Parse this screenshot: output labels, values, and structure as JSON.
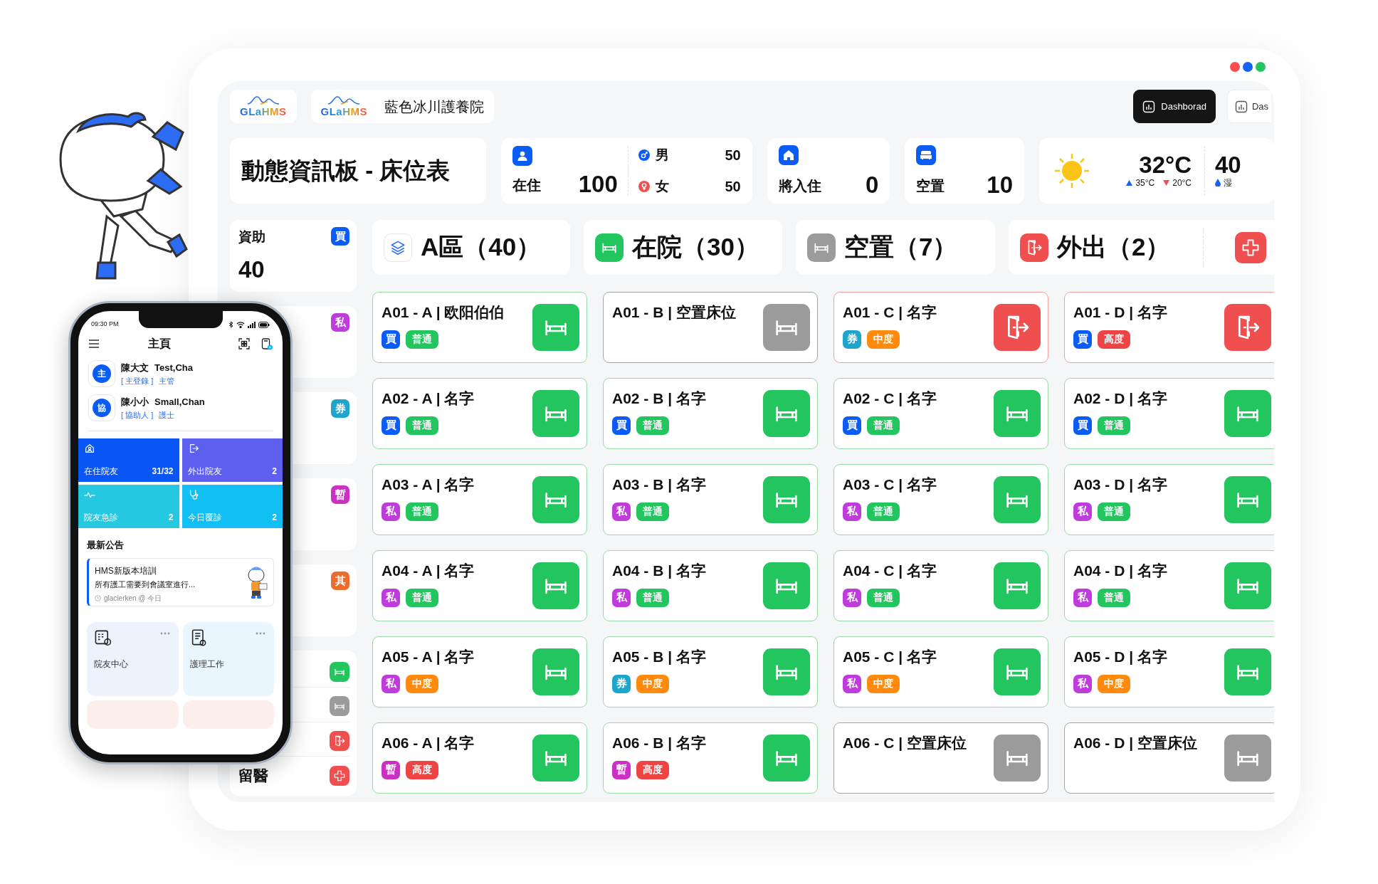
{
  "window_controls": [
    {
      "color": "#ff4d4f"
    },
    {
      "color": "#1463f3"
    },
    {
      "color": "#22c55e"
    }
  ],
  "header": {
    "logos": [
      {
        "text": "GLaHMS"
      },
      {
        "text": "GLaHMS",
        "facility": "藍色冰川護養院"
      }
    ],
    "tabs": [
      {
        "label": "Dashborad",
        "selected": true
      },
      {
        "label": "Das",
        "selected": false
      }
    ]
  },
  "stats": {
    "title": "動態資訊板 - 床位表",
    "residents": {
      "label": "在住",
      "value": "100",
      "male": {
        "label": "男",
        "value": "50"
      },
      "female": {
        "label": "女",
        "value": "50"
      }
    },
    "cards": [
      {
        "kind": "incoming",
        "label": "將入住",
        "value": "0"
      },
      {
        "kind": "vacant",
        "label": "空置",
        "value": "10"
      }
    ],
    "weather": {
      "temp": "32°C",
      "high": "35°C",
      "low": "20°C",
      "humidity": "40",
      "humidity_label": "湿"
    }
  },
  "sidebar": {
    "items": [
      {
        "kind": "stat",
        "label": "資助",
        "value": "40",
        "badge": "買",
        "color": "#0b5cf5"
      },
      {
        "kind": "stat",
        "badge": "私",
        "color": "#c03bdc"
      },
      {
        "kind": "stat",
        "badge": "券",
        "color": "#1ea5cc"
      },
      {
        "kind": "stat",
        "badge": "暫",
        "color": "#cc2fc4"
      },
      {
        "kind": "stat",
        "badge": "其",
        "color": "#ec6b2d"
      },
      {
        "kind": "legend",
        "rows": [
          {
            "kind": "in"
          },
          {
            "kind": "vacant"
          },
          {
            "kind": "out"
          },
          {
            "kind": "hospital",
            "label": "留醫"
          }
        ]
      }
    ]
  },
  "sections": [
    {
      "kind": "zone",
      "label": "A區（40）"
    },
    {
      "kind": "in",
      "label": "在院（30）"
    },
    {
      "kind": "vacant",
      "label": "空置（7）"
    },
    {
      "kind": "out",
      "label": "外出（2）",
      "extra": {
        "kind": "hospital"
      }
    }
  ],
  "beds": [
    {
      "title": "A01 - A | 欧阳伯伯",
      "kind": "in",
      "funding": {
        "text": "買",
        "color": "#0b5cf5"
      },
      "level": {
        "text": "普通",
        "color": "#22c55e"
      }
    },
    {
      "title": "A01 - B | 空置床位",
      "kind": "vacant"
    },
    {
      "title": "A01 - C | 名字",
      "kind": "out",
      "funding": {
        "text": "券",
        "color": "#1ea5cc"
      },
      "level": {
        "text": "中度",
        "color": "#ff8a0d"
      }
    },
    {
      "title": "A01 - D | 名字",
      "kind": "out",
      "funding": {
        "text": "買",
        "color": "#0b5cf5"
      },
      "level": {
        "text": "高度",
        "color": "#ef4444"
      }
    },
    {
      "title": "A02 - A | 名字",
      "kind": "in",
      "funding": {
        "text": "買",
        "color": "#0b5cf5"
      },
      "level": {
        "text": "普通",
        "color": "#22c55e"
      }
    },
    {
      "title": "A02 - B | 名字",
      "kind": "in",
      "funding": {
        "text": "買",
        "color": "#0b5cf5"
      },
      "level": {
        "text": "普通",
        "color": "#22c55e"
      }
    },
    {
      "title": "A02 - C | 名字",
      "kind": "in",
      "funding": {
        "text": "買",
        "color": "#0b5cf5"
      },
      "level": {
        "text": "普通",
        "color": "#22c55e"
      }
    },
    {
      "title": "A02 - D | 名字",
      "kind": "in",
      "funding": {
        "text": "買",
        "color": "#0b5cf5"
      },
      "level": {
        "text": "普通",
        "color": "#22c55e"
      }
    },
    {
      "title": "A03 - A | 名字",
      "kind": "in",
      "funding": {
        "text": "私",
        "color": "#c03bdc"
      },
      "level": {
        "text": "普通",
        "color": "#22c55e"
      }
    },
    {
      "title": "A03 - B | 名字",
      "kind": "in",
      "funding": {
        "text": "私",
        "color": "#c03bdc"
      },
      "level": {
        "text": "普通",
        "color": "#22c55e"
      }
    },
    {
      "title": "A03 - C | 名字",
      "kind": "in",
      "funding": {
        "text": "私",
        "color": "#c03bdc"
      },
      "level": {
        "text": "普通",
        "color": "#22c55e"
      }
    },
    {
      "title": "A03 - D | 名字",
      "kind": "in",
      "funding": {
        "text": "私",
        "color": "#c03bdc"
      },
      "level": {
        "text": "普通",
        "color": "#22c55e"
      }
    },
    {
      "title": "A04 - A | 名字",
      "kind": "in",
      "funding": {
        "text": "私",
        "color": "#c03bdc"
      },
      "level": {
        "text": "普通",
        "color": "#22c55e"
      }
    },
    {
      "title": "A04 - B | 名字",
      "kind": "in",
      "funding": {
        "text": "私",
        "color": "#c03bdc"
      },
      "level": {
        "text": "普通",
        "color": "#22c55e"
      }
    },
    {
      "title": "A04 - C | 名字",
      "kind": "in",
      "funding": {
        "text": "私",
        "color": "#c03bdc"
      },
      "level": {
        "text": "普通",
        "color": "#22c55e"
      }
    },
    {
      "title": "A04 - D | 名字",
      "kind": "in",
      "funding": {
        "text": "私",
        "color": "#c03bdc"
      },
      "level": {
        "text": "普通",
        "color": "#22c55e"
      }
    },
    {
      "title": "A05 - A | 名字",
      "kind": "in",
      "funding": {
        "text": "私",
        "color": "#c03bdc"
      },
      "level": {
        "text": "中度",
        "color": "#ff8a0d"
      }
    },
    {
      "title": "A05 - B | 名字",
      "kind": "in",
      "funding": {
        "text": "券",
        "color": "#1ea5cc"
      },
      "level": {
        "text": "中度",
        "color": "#ff8a0d"
      }
    },
    {
      "title": "A05 - C | 名字",
      "kind": "in",
      "funding": {
        "text": "私",
        "color": "#c03bdc"
      },
      "level": {
        "text": "中度",
        "color": "#ff8a0d"
      }
    },
    {
      "title": "A05 - D | 名字",
      "kind": "in",
      "funding": {
        "text": "私",
        "color": "#c03bdc"
      },
      "level": {
        "text": "中度",
        "color": "#ff8a0d"
      }
    },
    {
      "title": "A06 - A | 名字",
      "kind": "in",
      "funding": {
        "text": "暫",
        "color": "#cc2fc4"
      },
      "level": {
        "text": "高度",
        "color": "#ef4444"
      }
    },
    {
      "title": "A06 - B | 名字",
      "kind": "in",
      "funding": {
        "text": "暫",
        "color": "#cc2fc4"
      },
      "level": {
        "text": "高度",
        "color": "#ef4444"
      }
    },
    {
      "title": "A06 - C | 空置床位",
      "kind": "vacant"
    },
    {
      "title": "A06 - D | 空置床位",
      "kind": "vacant"
    }
  ],
  "phone": {
    "time": "09:30 PM",
    "title": "主頁",
    "users": [
      {
        "badge": "主",
        "name": "陳大文",
        "english": "Test,Cha",
        "role_tag": "[ 主登錄 ]",
        "role": "主管"
      },
      {
        "badge": "協",
        "name": "陳小小",
        "english": "Small,Chan",
        "role_tag": "[ 協助人 ]",
        "role": "護士"
      }
    ],
    "tiles": [
      {
        "kind": "residents",
        "label": "在住院友",
        "value": "31/32",
        "color": "#0a56f5"
      },
      {
        "kind": "out",
        "label": "外出院友",
        "value": "2",
        "color": "#5d5fef"
      },
      {
        "kind": "emergency",
        "label": "院友急診",
        "value": "2",
        "color": "#24c8e0"
      },
      {
        "kind": "followup",
        "label": "今日覆診",
        "value": "2",
        "color": "#12bff5"
      }
    ],
    "notice_heading": "最新公告",
    "notice": {
      "title": "HMS新版本培訓",
      "body": "所有護工需要到會議室進行...",
      "meta": "glacierken @ 今日"
    },
    "shortcuts": [
      {
        "kind": "residents",
        "label": "院友中心"
      },
      {
        "kind": "nursing",
        "label": "護理工作"
      }
    ]
  }
}
